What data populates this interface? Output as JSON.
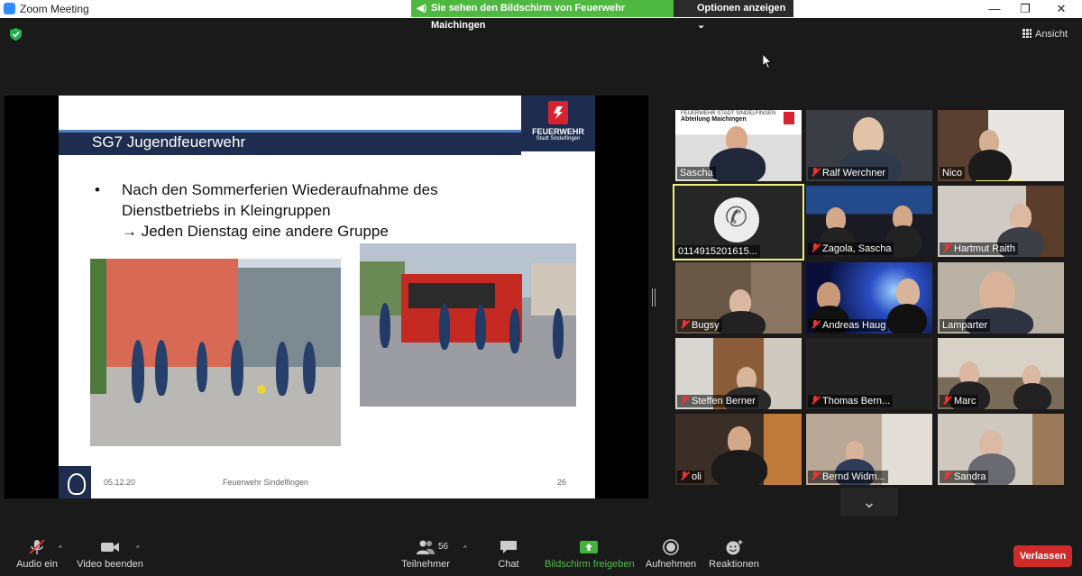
{
  "window": {
    "title": "Zoom Meeting",
    "minimize": "—",
    "maximize": "❐",
    "close": "✕"
  },
  "banner": {
    "text": "Sie sehen den Bildschirm von Feuerwehr Maichingen",
    "options": "Optionen anzeigen",
    "options_caret": "⌄"
  },
  "view_button": "Ansicht",
  "slide": {
    "title": "SG7 Jugendfeuerwehr",
    "bullet": "•",
    "line1": "Nach den Sommerferien Wiederaufnahme des",
    "line2": "Dienstbetriebs in Kleingruppen",
    "line3": "→ Jeden Dienstag eine andere Gruppe",
    "logo_title": "FEUERWEHR",
    "logo_sub": "Stadt Sindelfingen",
    "footer_date": "05.12.20",
    "footer_org": "Feuerwehr Sindelfingen",
    "footer_page": "26"
  },
  "participants": [
    {
      "name": "Sascha",
      "muted": false,
      "sign_line1": "FEUERWEHR STADT SINDELFINGEN",
      "sign_line2": "Abteilung Maichingen"
    },
    {
      "name": "Ralf Werchner",
      "muted": true
    },
    {
      "name": "Nico",
      "muted": false
    },
    {
      "name": "0114915201615...",
      "muted": false,
      "phone": true,
      "active": true
    },
    {
      "name": "Zagola, Sascha",
      "muted": true
    },
    {
      "name": "Hartmut Raith",
      "muted": true
    },
    {
      "name": "Bugsy",
      "muted": true
    },
    {
      "name": "Andreas Haug",
      "muted": true
    },
    {
      "name": "Lamparter",
      "muted": false
    },
    {
      "name": "Steffen Berner",
      "muted": true
    },
    {
      "name": "Thomas Bern...",
      "muted": true
    },
    {
      "name": "Marc",
      "muted": true
    },
    {
      "name": "oli",
      "muted": true
    },
    {
      "name": "Bernd Widm...",
      "muted": true
    },
    {
      "name": "Sandra",
      "muted": true
    }
  ],
  "scroll_down": "⌄",
  "toolbar": {
    "audio": "Audio ein",
    "video": "Video beenden",
    "participants": "Teilnehmer",
    "participants_count": "56",
    "chat": "Chat",
    "share": "Bildschirm freigeben",
    "record": "Aufnehmen",
    "reactions": "Reaktionen",
    "leave": "Verlassen",
    "caret": "^"
  },
  "colors": {
    "share_green": "#4fb840",
    "leave_red": "#d12a2a",
    "active_speaker": "#f2f27a",
    "slide_navy": "#1e2d4f"
  },
  "icons": [
    "zoom-app-icon",
    "speaker-icon",
    "shield-icon",
    "grid-icon",
    "cursor-icon",
    "phone-icon",
    "muted-mic-icon",
    "mic-off-icon",
    "video-icon",
    "participants-icon",
    "chat-icon",
    "share-screen-icon",
    "record-icon",
    "reactions-icon"
  ]
}
